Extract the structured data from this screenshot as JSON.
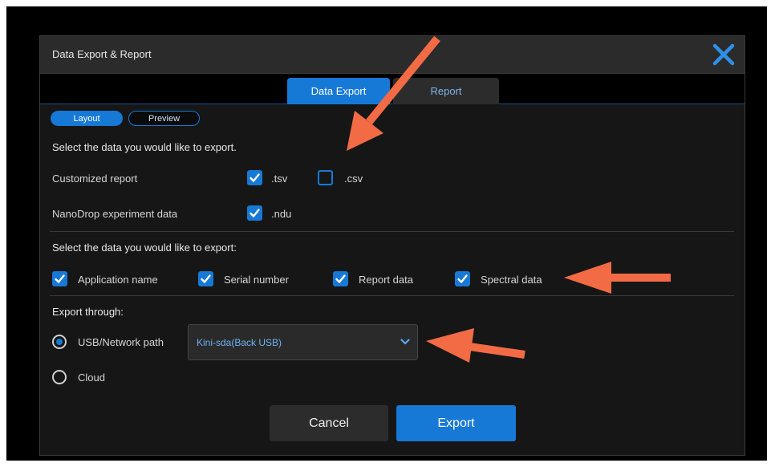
{
  "dialog": {
    "title": "Data Export & Report",
    "close_icon": "close-x-icon"
  },
  "tabs": [
    {
      "label": "Data Export",
      "active": true
    },
    {
      "label": "Report",
      "active": false
    }
  ],
  "subtabs": [
    {
      "label": "Layout",
      "active": true
    },
    {
      "label": "Preview",
      "active": false
    }
  ],
  "section1": {
    "heading": "Select the data you would like to export.",
    "rows": [
      {
        "label": "Customized report",
        "options": [
          {
            "label": ".tsv",
            "checked": true
          },
          {
            "label": ".csv",
            "checked": false
          }
        ]
      },
      {
        "label": "NanoDrop experiment data",
        "options": [
          {
            "label": ".ndu",
            "checked": true
          }
        ]
      }
    ]
  },
  "section2": {
    "heading": "Select the data you would like to export:",
    "options": [
      {
        "label": "Application name",
        "checked": true
      },
      {
        "label": "Serial number",
        "checked": true
      },
      {
        "label": "Report data",
        "checked": true
      },
      {
        "label": "Spectral data",
        "checked": true
      }
    ]
  },
  "section3": {
    "heading": "Export through:",
    "usb_label": "USB/Network path",
    "usb_selected": true,
    "path_value": "Kini-sda(Back USB)",
    "cloud_label": "Cloud",
    "cloud_selected": false
  },
  "buttons": {
    "cancel": "Cancel",
    "export": "Export"
  },
  "colors": {
    "accent": "#1779d6",
    "annotation_arrow": "#f26b45"
  }
}
